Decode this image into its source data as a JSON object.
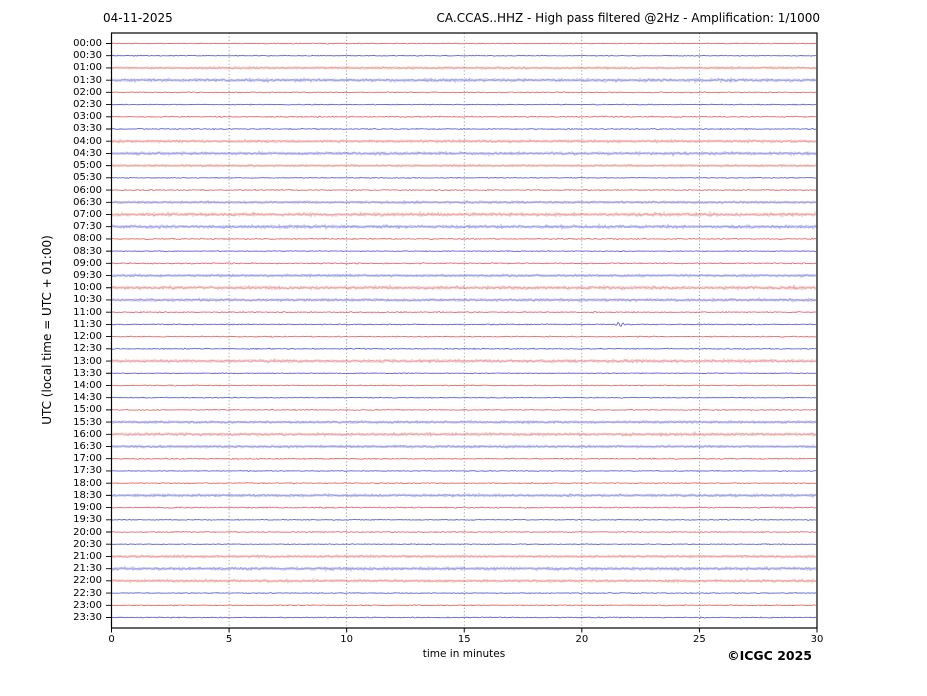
{
  "header": {
    "date": "04-11-2025",
    "title": "CA.CCAS..HHZ - High pass filtered @2Hz - Amplification: 1/1000"
  },
  "footer": {
    "copyright": "©ICGC 2025"
  },
  "chart_data": {
    "type": "line",
    "subtype": "helicorder-seismogram",
    "station": "CA.CCAS..HHZ",
    "filter": "High pass filtered @2Hz",
    "amplification": "1/1000",
    "date": "04-11-2025",
    "xlabel": "time in minutes",
    "ylabel": "UTC (local time = UTC + 01:00)",
    "xlim": [
      0,
      30
    ],
    "x_ticks": [
      0,
      5,
      10,
      15,
      20,
      25,
      30
    ],
    "minutes_per_row": 30,
    "grid": "vertical dashed gridlines every 5 minutes",
    "legend": "none",
    "colors": {
      "red": "#dc5f5f",
      "blue": "#5353cd",
      "grid": "#8a8a8a",
      "frame": "#000000",
      "background": "#ffffff"
    },
    "rows": [
      {
        "time": "00:00",
        "color": "red",
        "faint": false,
        "amplitude": 0.5
      },
      {
        "time": "00:30",
        "color": "blue",
        "faint": false,
        "amplitude": 0.5
      },
      {
        "time": "01:00",
        "color": "red",
        "faint": true,
        "amplitude": 0.9
      },
      {
        "time": "01:30",
        "color": "blue",
        "faint": true,
        "amplitude": 1.3
      },
      {
        "time": "02:00",
        "color": "red",
        "faint": false,
        "amplitude": 0.6
      },
      {
        "time": "02:30",
        "color": "blue",
        "faint": false,
        "amplitude": 0.5
      },
      {
        "time": "03:00",
        "color": "red",
        "faint": false,
        "amplitude": 0.7
      },
      {
        "time": "03:30",
        "color": "blue",
        "faint": false,
        "amplitude": 0.6
      },
      {
        "time": "04:00",
        "color": "red",
        "faint": true,
        "amplitude": 1.1
      },
      {
        "time": "04:30",
        "color": "blue",
        "faint": true,
        "amplitude": 1.2
      },
      {
        "time": "05:00",
        "color": "red",
        "faint": true,
        "amplitude": 0.8
      },
      {
        "time": "05:30",
        "color": "blue",
        "faint": false,
        "amplitude": 0.5
      },
      {
        "time": "06:00",
        "color": "red",
        "faint": false,
        "amplitude": 0.7
      },
      {
        "time": "06:30",
        "color": "blue",
        "faint": true,
        "amplitude": 0.9
      },
      {
        "time": "07:00",
        "color": "red",
        "faint": true,
        "amplitude": 1.4
      },
      {
        "time": "07:30",
        "color": "blue",
        "faint": true,
        "amplitude": 1.4
      },
      {
        "time": "08:00",
        "color": "red",
        "faint": false,
        "amplitude": 0.7
      },
      {
        "time": "08:30",
        "color": "blue",
        "faint": false,
        "amplitude": 0.5
      },
      {
        "time": "09:00",
        "color": "red",
        "faint": false,
        "amplitude": 0.7
      },
      {
        "time": "09:30",
        "color": "blue",
        "faint": true,
        "amplitude": 1.0
      },
      {
        "time": "10:00",
        "color": "red",
        "faint": true,
        "amplitude": 1.5
      },
      {
        "time": "10:30",
        "color": "blue",
        "faint": true,
        "amplitude": 1.1
      },
      {
        "time": "11:00",
        "color": "red",
        "faint": false,
        "amplitude": 0.7
      },
      {
        "time": "11:30",
        "color": "blue",
        "faint": false,
        "amplitude": 0.6
      },
      {
        "time": "12:00",
        "color": "red",
        "faint": false,
        "amplitude": 0.6
      },
      {
        "time": "12:30",
        "color": "blue",
        "faint": false,
        "amplitude": 0.6
      },
      {
        "time": "13:00",
        "color": "red",
        "faint": true,
        "amplitude": 1.3
      },
      {
        "time": "13:30",
        "color": "blue",
        "faint": false,
        "amplitude": 0.5
      },
      {
        "time": "14:00",
        "color": "red",
        "faint": false,
        "amplitude": 0.6
      },
      {
        "time": "14:30",
        "color": "blue",
        "faint": false,
        "amplitude": 0.5
      },
      {
        "time": "15:00",
        "color": "red",
        "faint": false,
        "amplitude": 0.6
      },
      {
        "time": "15:30",
        "color": "blue",
        "faint": true,
        "amplitude": 1.0
      },
      {
        "time": "16:00",
        "color": "red",
        "faint": true,
        "amplitude": 1.3
      },
      {
        "time": "16:30",
        "color": "blue",
        "faint": true,
        "amplitude": 1.0
      },
      {
        "time": "17:00",
        "color": "red",
        "faint": false,
        "amplitude": 0.7
      },
      {
        "time": "17:30",
        "color": "blue",
        "faint": false,
        "amplitude": 0.5
      },
      {
        "time": "18:00",
        "color": "red",
        "faint": false,
        "amplitude": 0.6
      },
      {
        "time": "18:30",
        "color": "blue",
        "faint": true,
        "amplitude": 1.1
      },
      {
        "time": "19:00",
        "color": "red",
        "faint": false,
        "amplitude": 0.7
      },
      {
        "time": "19:30",
        "color": "blue",
        "faint": false,
        "amplitude": 0.5
      },
      {
        "time": "20:00",
        "color": "red",
        "faint": false,
        "amplitude": 0.6
      },
      {
        "time": "20:30",
        "color": "blue",
        "faint": false,
        "amplitude": 0.5
      },
      {
        "time": "21:00",
        "color": "red",
        "faint": true,
        "amplitude": 1.0
      },
      {
        "time": "21:30",
        "color": "blue",
        "faint": true,
        "amplitude": 1.3
      },
      {
        "time": "22:00",
        "color": "red",
        "faint": true,
        "amplitude": 1.1
      },
      {
        "time": "22:30",
        "color": "blue",
        "faint": false,
        "amplitude": 0.5
      },
      {
        "time": "23:00",
        "color": "red",
        "faint": false,
        "amplitude": 0.6
      },
      {
        "time": "23:30",
        "color": "blue",
        "faint": false,
        "amplitude": 0.6
      }
    ],
    "events": [
      {
        "row": "11:30",
        "minute": 21.6,
        "amplitude": 2.2,
        "description": "small transient blip"
      }
    ]
  }
}
